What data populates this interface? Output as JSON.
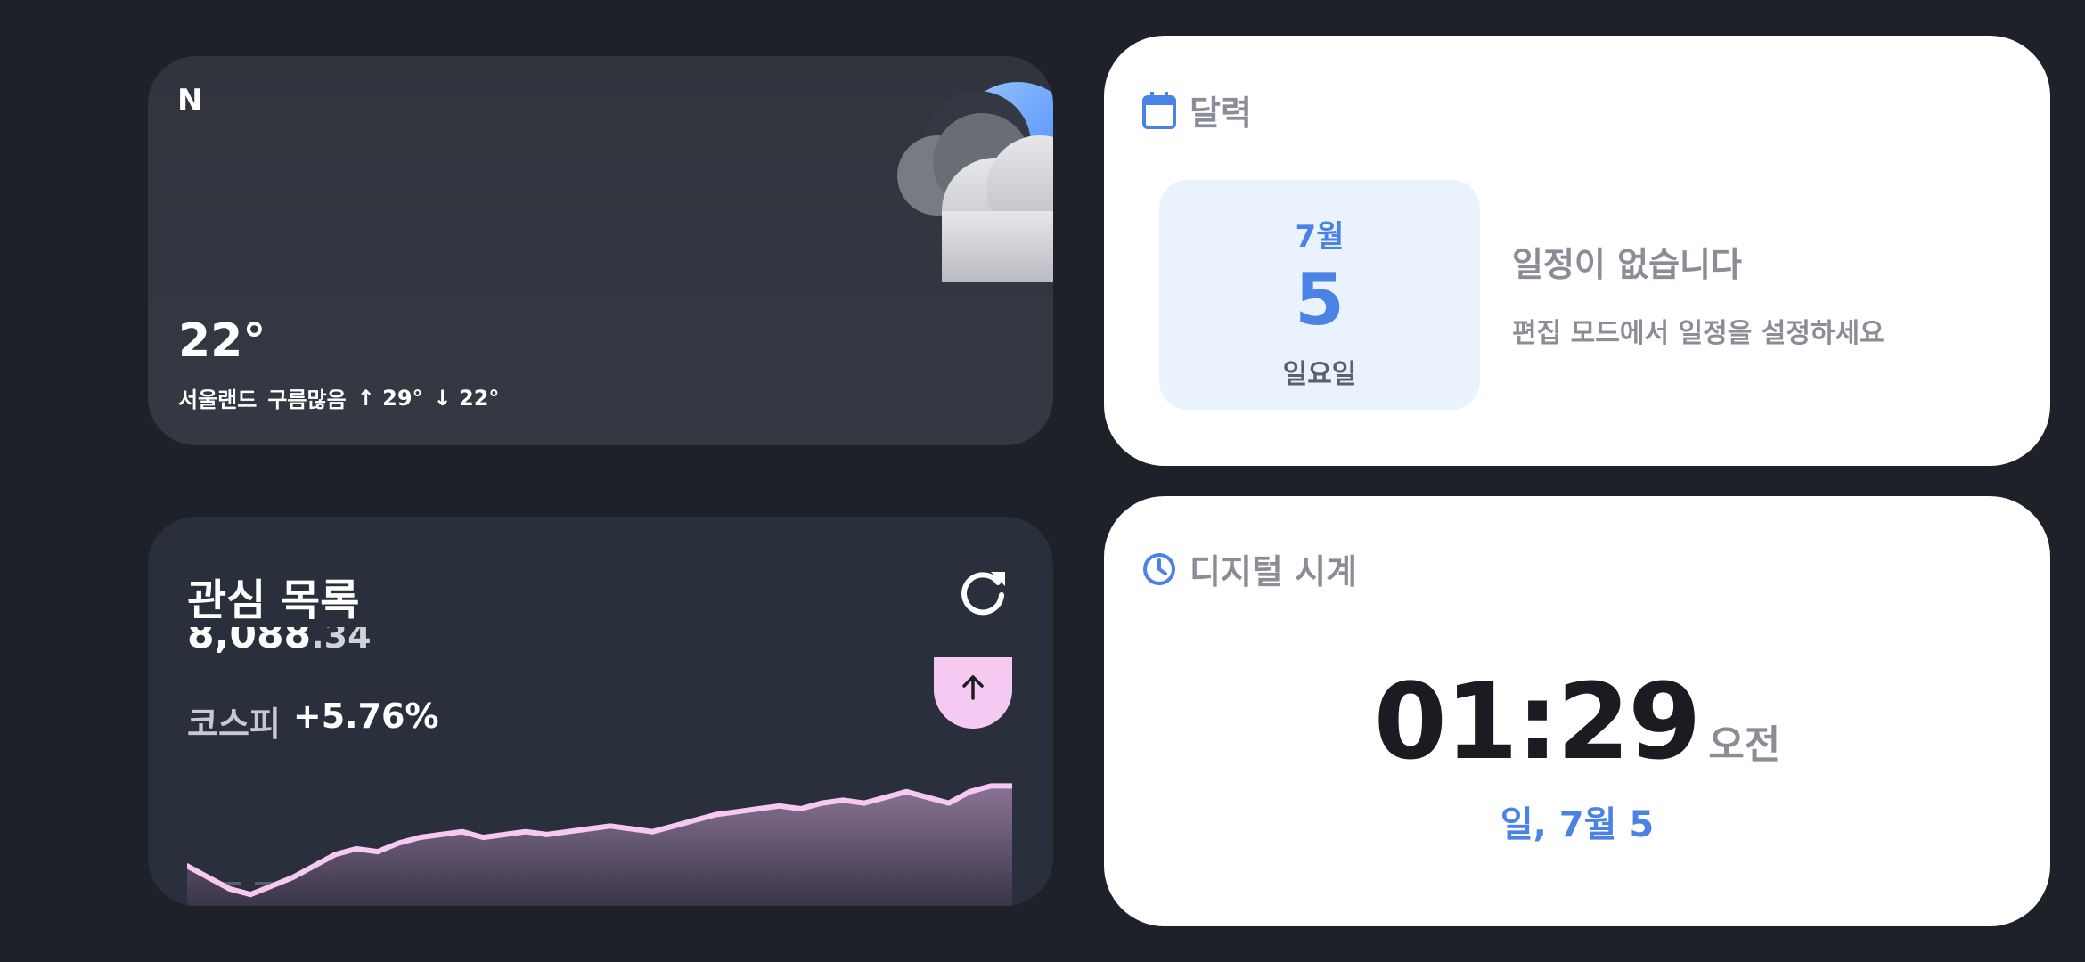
{
  "weather": {
    "logo": "N",
    "temperature": "22°",
    "location": "서울랜드",
    "condition": "구름많음",
    "high": "↑ 29°",
    "low": "↓ 22°"
  },
  "calendar": {
    "title": "달력",
    "month": "7월",
    "day": "5",
    "weekday": "일요일",
    "empty_title": "일정이 없습니다",
    "empty_sub": "편집 모드에서 일정을 설정하세요"
  },
  "watchlist": {
    "title": "관심 목록",
    "price_int": "8,088",
    "price_dec": ".34",
    "index_name": "코스피",
    "index_change": "+5.76%",
    "chart_data": {
      "type": "area",
      "values": [
        52,
        48,
        44,
        42,
        45,
        48,
        52,
        56,
        58,
        57,
        60,
        62,
        63,
        64,
        62,
        63,
        64,
        63,
        64,
        65,
        66,
        65,
        64,
        66,
        68,
        70,
        71,
        72,
        73,
        72,
        74,
        75,
        74,
        76,
        78,
        76,
        74,
        78,
        80,
        80
      ]
    }
  },
  "clock": {
    "title": "디지털 시계",
    "time": "01:29",
    "ampm": "오전",
    "date": "일, 7월 5"
  },
  "colors": {
    "background": "#1f2128",
    "accent_blue": "#4a82e6",
    "chart_line": "#f6c9f3"
  }
}
